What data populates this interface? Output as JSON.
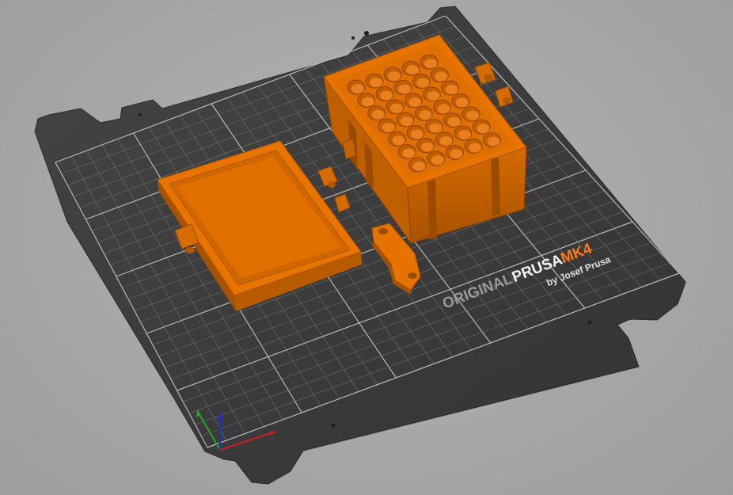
{
  "viewport": {
    "background": "#a9a9a9",
    "bed": {
      "brand_line": "ORIGINAL",
      "brand_name": "PRUSA",
      "model": "MK4",
      "byline": "by Josef Prusa",
      "sheet_color": "#3b3b3b",
      "grid_color": "#8a8a8a",
      "model_accent": "#ff7a1a"
    },
    "objects": [
      {
        "name": "lid",
        "color": "#e67300"
      },
      {
        "name": "box-with-holes",
        "color": "#e67300"
      },
      {
        "name": "hinge-bracket",
        "color": "#e67300"
      }
    ],
    "axes": {
      "x": "#c92020",
      "y": "#2aa02a",
      "z": "#2030c0"
    }
  }
}
